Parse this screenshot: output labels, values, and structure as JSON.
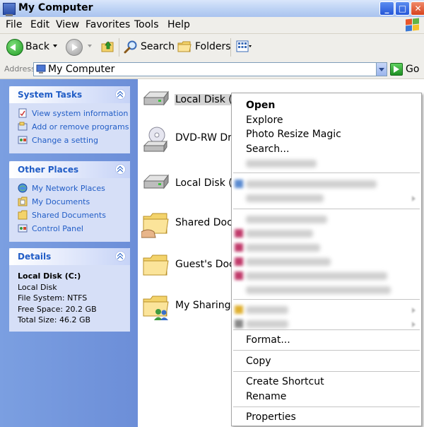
{
  "window": {
    "title": "My Computer"
  },
  "menubar": [
    "File",
    "Edit",
    "View",
    "Favorites",
    "Tools",
    "Help"
  ],
  "toolbar": {
    "back_label": "Back",
    "search_label": "Search",
    "folders_label": "Folders"
  },
  "address": {
    "label": "Address",
    "value": "My Computer",
    "go_label": "Go"
  },
  "sidebar": {
    "system_tasks": {
      "title": "System Tasks",
      "items": [
        "View system information",
        "Add or remove programs",
        "Change a setting"
      ]
    },
    "other_places": {
      "title": "Other Places",
      "items": [
        "My Network Places",
        "My Documents",
        "Shared Documents",
        "Control Panel"
      ]
    },
    "details": {
      "title": "Details",
      "name": "Local Disk (C:)",
      "type": "Local Disk",
      "file_system": "File System: NTFS",
      "free_space": "Free Space: 20.2 GB",
      "total_size": "Total Size: 46.2 GB"
    }
  },
  "content": {
    "items": [
      {
        "label": "Local Disk (C:",
        "icon": "hard-disk-icon"
      },
      {
        "label": "DVD-RW Driv",
        "icon": "dvd-drive-icon"
      },
      {
        "label": "Local Disk (E",
        "icon": "hard-disk-icon"
      },
      {
        "label": "Shared Docu",
        "icon": "shared-folder-icon"
      },
      {
        "label": "Guest's Docu",
        "icon": "folder-icon"
      },
      {
        "label": "My Sharing F",
        "icon": "sharing-folder-icon"
      }
    ]
  },
  "context_menu": {
    "open": "Open",
    "explore": "Explore",
    "photo_resize": "Photo Resize Magic",
    "search": "Search...",
    "format": "Format...",
    "copy": "Copy",
    "create_shortcut": "Create Shortcut",
    "rename": "Rename",
    "properties": "Properties"
  }
}
